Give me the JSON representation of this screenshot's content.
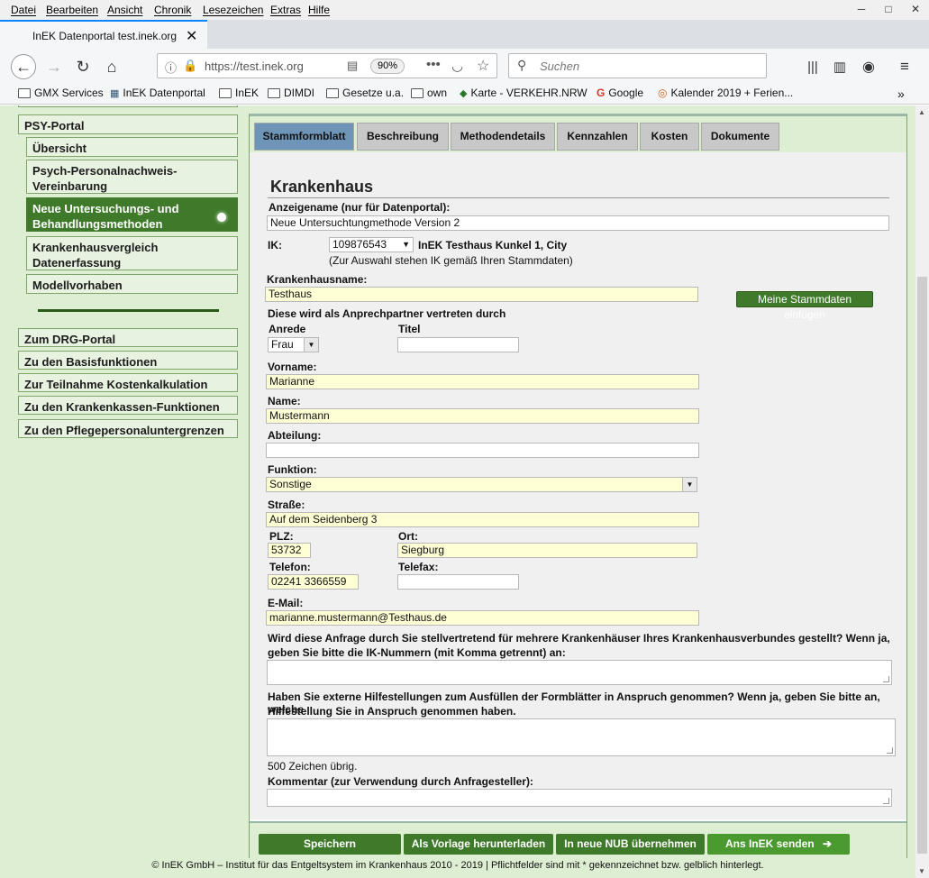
{
  "menubar": {
    "items": [
      "Datei",
      "Bearbeiten",
      "Ansicht",
      "Chronik",
      "Lesezeichen",
      "Extras",
      "Hilfe"
    ]
  },
  "tab": {
    "title": "InEK Datenportal test.inek.org",
    "close": "✕"
  },
  "navbar": {
    "url": "https://test.inek.org",
    "zoom": "90%",
    "search_placeholder": "Suchen"
  },
  "bookmarks": [
    "GMX Services",
    "InEK Datenportal",
    "InEK",
    "DIMDI",
    "Gesetze u.a.",
    "own",
    "Karte - VERKEHR.NRW",
    "Google",
    "Kalender 2019 + Ferien..."
  ],
  "sidebar": {
    "portal": "PSY-Portal",
    "items": [
      "Übersicht",
      "Psych-Personalnachweis-Vereinbarung",
      "Neue Untersuchungs- und Behandlungsmethoden",
      "Krankenhausvergleich Datenerfassung",
      "Modellvorhaben"
    ],
    "links": [
      "Zum DRG-Portal",
      "Zu den Basisfunktionen",
      "Zur Teilnahme Kostenkalkulation",
      "Zu den Krankenkassen-Funktionen",
      "Zu den Pflegepersonaluntergrenzen"
    ]
  },
  "tabs": [
    "Stammformblatt",
    "Beschreibung",
    "Methodendetails",
    "Kennzahlen",
    "Kosten",
    "Dokumente"
  ],
  "form": {
    "heading": "Krankenhaus",
    "anzeigename_label": "Anzeigename (nur für Datenportal):",
    "anzeigename_value": "Neue Untersuchtungmethode Version 2",
    "ik_label": "IK:",
    "ik_value": "109876543",
    "ik_name": "InEK Testhaus Kunkel 1, City",
    "ik_hint": "(Zur Auswahl stehen IK gemäß Ihren Stammdaten)",
    "khname_label": "Krankenhausname:",
    "khname_value": "Testhaus",
    "stammdaten_button": "Meine Stammdaten einfügen",
    "contact_intro": "Diese wird als Anprechpartner vertreten durch",
    "anrede_label": "Anrede",
    "anrede_value": "Frau",
    "titel_label": "Titel",
    "vorname_label": "Vorname:",
    "vorname_value": "Marianne",
    "name_label": "Name:",
    "name_value": "Mustermann",
    "abteilung_label": "Abteilung:",
    "funktion_label": "Funktion:",
    "funktion_value": "Sonstige",
    "strasse_label": "Straße:",
    "strasse_value": "Auf dem Seidenberg 3",
    "plz_label": "PLZ:",
    "plz_value": "53732",
    "ort_label": "Ort:",
    "ort_value": "Siegburg",
    "telefon_label": "Telefon:",
    "telefon_value": "02241 3366559",
    "telefax_label": "Telefax:",
    "email_label": "E-Mail:",
    "email_value": "marianne.mustermann@Testhaus.de",
    "q1_line1": "Wird diese Anfrage durch Sie stellvertretend für mehrere Krankenhäuser Ihres Krankenhausverbundes gestellt? Wenn ja,",
    "q1_line2": "geben Sie bitte die IK-Nummern (mit Komma getrennt) an:",
    "q2_line1": "Haben Sie externe Hilfestellungen zum Ausfüllen der Formblätter in Anspruch genommen? Wenn ja, geben Sie bitte an, welche",
    "q2_line2": "Hilfestellung Sie in Anspruch genommen haben.",
    "chars_left": "500 Zeichen übrig.",
    "kommentar_label": "Kommentar (zur Verwendung durch Anfragesteller):"
  },
  "buttons": {
    "save": "Speichern",
    "template": "Als Vorlage herunterladen",
    "nub": "In neue NUB übernehmen",
    "send": "Ans InEK senden"
  },
  "footer": "© InEK GmbH – Institut für das Entgeltsystem im Krankenhaus 2010 - 2019 | Pflichtfelder sind mit * gekennzeichnet bzw. gelblich hinterlegt."
}
